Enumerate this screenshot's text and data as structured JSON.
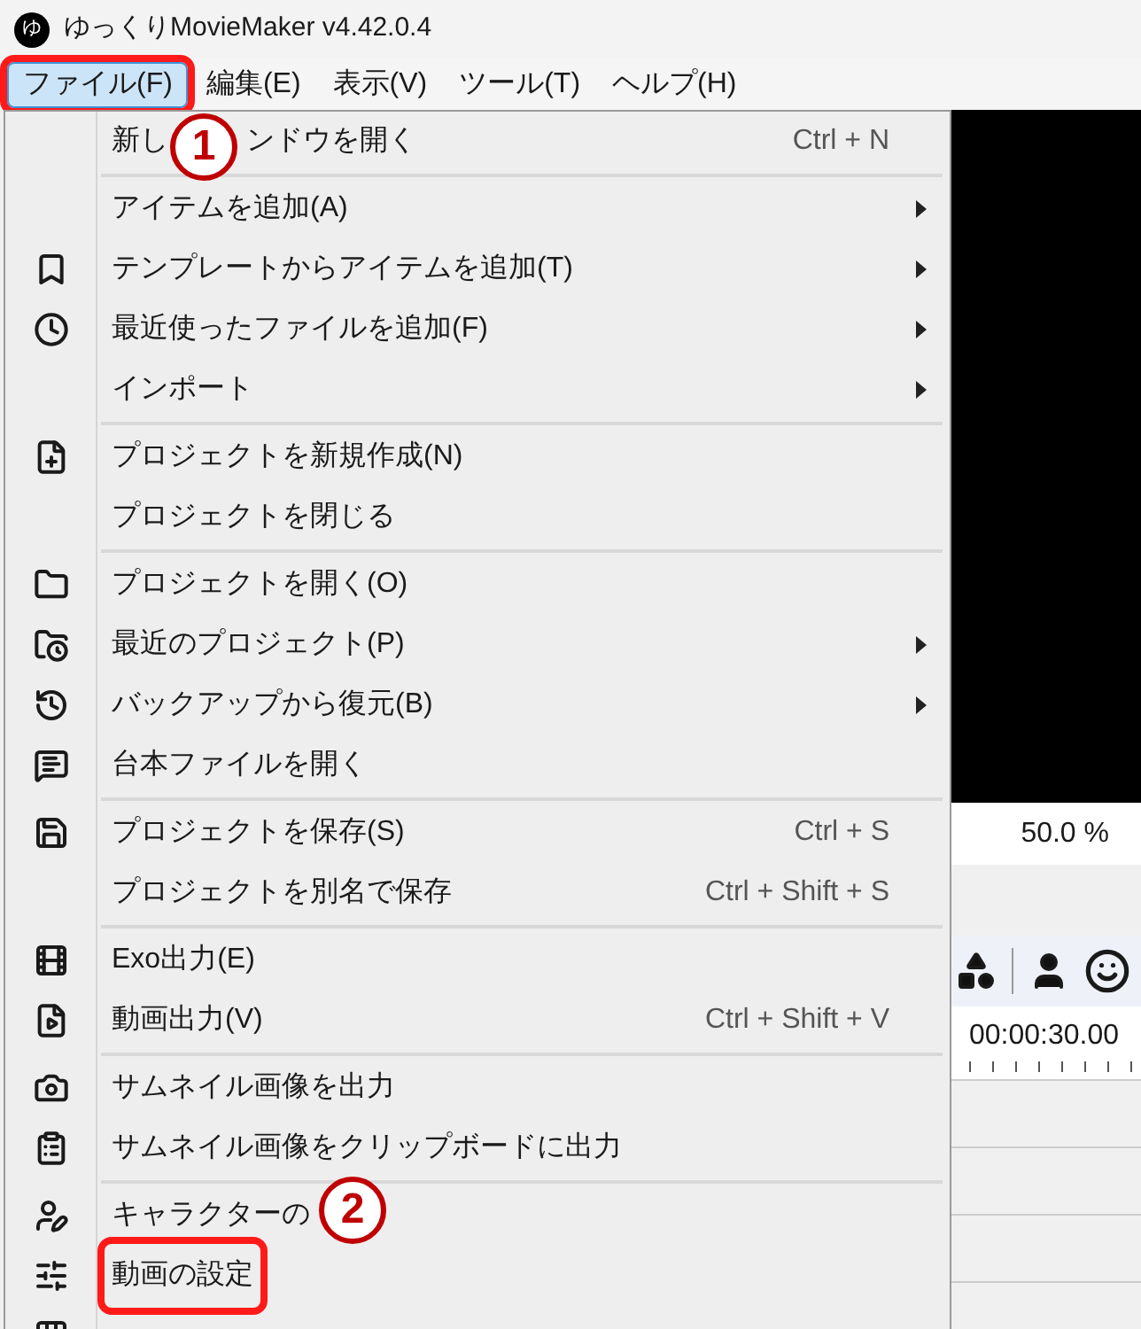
{
  "window": {
    "title": "ゆっくりMovieMaker v4.42.0.4",
    "app_icon_glyph": "ゆ"
  },
  "menu_bar": [
    {
      "label": "ファイル(F)",
      "selected": true,
      "highlighted": true
    },
    {
      "label": "編集(E)",
      "selected": false,
      "highlighted": false
    },
    {
      "label": "表示(V)",
      "selected": false,
      "highlighted": false
    },
    {
      "label": "ツール(T)",
      "selected": false,
      "highlighted": false
    },
    {
      "label": "ヘルプ(H)",
      "selected": false,
      "highlighted": false
    }
  ],
  "file_menu": [
    {
      "kind": "item",
      "label": "新し",
      "label_after": "ンドウを開く",
      "shortcut": "Ctrl + N",
      "submenu": false,
      "highlighted": false
    },
    {
      "kind": "separator"
    },
    {
      "kind": "item",
      "label": "アイテムを追加(A)",
      "submenu": true,
      "highlighted": false
    },
    {
      "kind": "item",
      "label": "テンプレートからアイテムを追加(T)",
      "submenu": true,
      "highlighted": false
    },
    {
      "kind": "item",
      "label": "最近使ったファイルを追加(F)",
      "submenu": true,
      "highlighted": false
    },
    {
      "kind": "item",
      "label": "インポート",
      "submenu": true,
      "highlighted": false
    },
    {
      "kind": "separator"
    },
    {
      "kind": "item",
      "label": "プロジェクトを新規作成(N)",
      "submenu": false,
      "highlighted": false
    },
    {
      "kind": "item",
      "label": "プロジェクトを閉じる",
      "submenu": false,
      "highlighted": false
    },
    {
      "kind": "separator"
    },
    {
      "kind": "item",
      "label": "プロジェクトを開く(O)",
      "submenu": false,
      "highlighted": false
    },
    {
      "kind": "item",
      "label": "最近のプロジェクト(P)",
      "submenu": true,
      "highlighted": false
    },
    {
      "kind": "item",
      "label": "バックアップから復元(B)",
      "submenu": true,
      "highlighted": false
    },
    {
      "kind": "item",
      "label": "台本ファイルを開く",
      "submenu": false,
      "highlighted": false
    },
    {
      "kind": "separator"
    },
    {
      "kind": "item",
      "label": "プロジェクトを保存(S)",
      "shortcut": "Ctrl + S",
      "submenu": false,
      "highlighted": false
    },
    {
      "kind": "item",
      "label": "プロジェクトを別名で保存",
      "shortcut": "Ctrl + Shift + S",
      "submenu": false,
      "highlighted": false
    },
    {
      "kind": "separator"
    },
    {
      "kind": "item",
      "label": "Exo出力(E)",
      "submenu": false,
      "highlighted": false
    },
    {
      "kind": "item",
      "label": "動画出力(V)",
      "shortcut": "Ctrl + Shift + V",
      "submenu": false,
      "highlighted": false
    },
    {
      "kind": "separator"
    },
    {
      "kind": "item",
      "label": "サムネイル画像を出力",
      "submenu": false,
      "highlighted": false
    },
    {
      "kind": "item",
      "label": "サムネイル画像をクリップボードに出力",
      "submenu": false,
      "highlighted": false
    },
    {
      "kind": "separator"
    },
    {
      "kind": "item",
      "label": "キャラクターの",
      "submenu": false,
      "highlighted": false
    },
    {
      "kind": "item",
      "label": "動画の設定",
      "submenu": false,
      "highlighted": true
    }
  ],
  "callouts": [
    "1",
    "2"
  ],
  "preview": {
    "zoom": "50.0 %",
    "timecode": "00:00:30.00"
  }
}
